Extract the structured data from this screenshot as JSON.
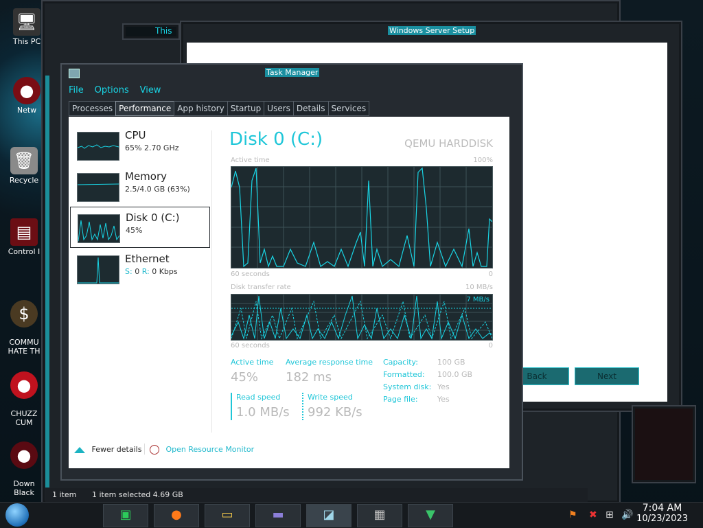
{
  "desktop": {
    "icons": [
      {
        "label": "This PC",
        "icon": "computer-icon"
      },
      {
        "label": "Netw",
        "icon": "network-icon"
      },
      {
        "label": "Recycle",
        "icon": "recycle-bin-icon"
      },
      {
        "label": "Control I",
        "icon": "control-panel-icon"
      },
      {
        "label": "COMMU\nHATE TH",
        "icon": "money-bag-icon"
      },
      {
        "label": "CHUZZ\nCUM",
        "icon": "chuzzle-icon"
      },
      {
        "label": "Down\nBlack",
        "icon": "download-icon"
      }
    ]
  },
  "explorer": {
    "breadcrumb": "This",
    "status_items": "1 item",
    "status_selected": "1 item selected  4.69 GB"
  },
  "setup_window": {
    "title": "Windows Server Setup",
    "back_label": "Back",
    "next_label": "Next"
  },
  "task_manager": {
    "title": "Task Manager",
    "menu": [
      "File",
      "Options",
      "View"
    ],
    "tabs": [
      "Processes",
      "Performance",
      "App history",
      "Startup",
      "Users",
      "Details",
      "Services"
    ],
    "active_tab": "Performance",
    "sidebar": [
      {
        "name": "CPU",
        "sub": "65%  2.70 GHz"
      },
      {
        "name": "Memory",
        "sub": "2.5/4.0 GB (63%)"
      },
      {
        "name": "Disk 0 (C:)",
        "sub": "45%"
      },
      {
        "name": "Ethernet",
        "sub_s": "S:",
        "sub_s_val": "0",
        "sub_r": "R:",
        "sub_r_val": "0 Kbps"
      }
    ],
    "disk": {
      "title": "Disk 0 (C:)",
      "model": "QEMU HARDDISK",
      "active_time_label": "Active time",
      "active_time_max": "100%",
      "seconds_label": "60 seconds",
      "zero": "0",
      "transfer_label": "Disk transfer rate",
      "transfer_max": "10 MB/s",
      "transfer_line": "7 MB/s",
      "stats": {
        "active_time_label": "Active time",
        "active_time_value": "45%",
        "response_label": "Average response time",
        "response_value": "182 ms",
        "read_label": "Read speed",
        "read_value": "1.0 MB/s",
        "write_label": "Write speed",
        "write_value": "992 KB/s"
      },
      "props": [
        {
          "k": "Capacity:",
          "v": "100 GB"
        },
        {
          "k": "Formatted:",
          "v": "100.0 GB"
        },
        {
          "k": "System disk:",
          "v": "Yes"
        },
        {
          "k": "Page file:",
          "v": "Yes"
        }
      ]
    },
    "footer": {
      "fewer_details": "Fewer details",
      "open_resource_monitor": "Open Resource Monitor"
    }
  },
  "taskbar": {
    "time": "7:04 AM",
    "date": "10/23/2023",
    "apps": [
      "notes-app-icon",
      "firefox-icon",
      "file-explorer-icon",
      "card-app-icon",
      "task-manager-icon",
      "wall-app-icon",
      "install-app-icon"
    ]
  },
  "colors": {
    "accent": "#1fc6d8",
    "frame": "#252a30"
  }
}
